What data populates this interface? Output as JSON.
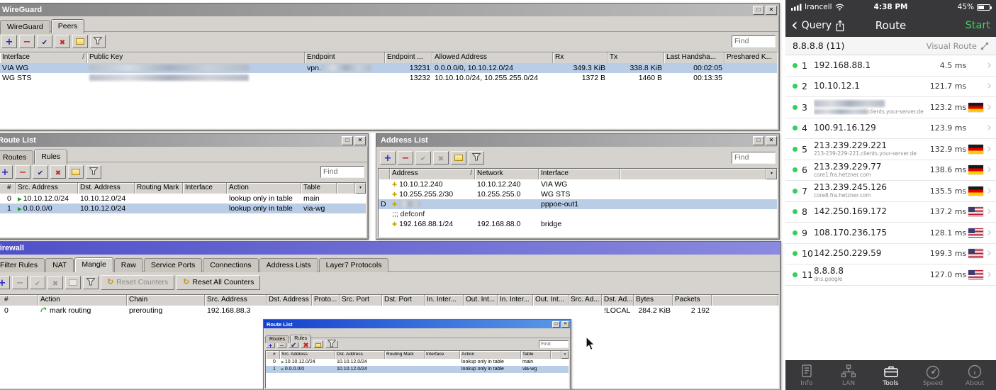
{
  "icons": {
    "maximize": "□",
    "close": "✕",
    "dropdown": "▾"
  },
  "colors": {
    "selection_blue": "#b9cde6",
    "titlebar_active": "#4f50c8",
    "ios_green": "#3fd15e",
    "hop_dot_green": "#35d05a"
  },
  "desktop": {
    "wireguard": {
      "title": "WireGuard",
      "tabs": [
        "WireGuard",
        "Peers"
      ],
      "active_tab": 1,
      "toolbar": [
        {
          "icon": "add-icon",
          "disabled": false
        },
        {
          "icon": "remove-icon",
          "disabled": false
        },
        {
          "icon": "enable-icon",
          "disabled": false
        },
        {
          "icon": "disable-icon",
          "disabled": false
        },
        {
          "icon": "comment-icon",
          "disabled": false
        },
        {
          "icon": "filter-icon",
          "disabled": false
        }
      ],
      "find_placeholder": "Find",
      "columns": [
        "Interface",
        "Public Key",
        "Endpoint",
        "Endpoint ...",
        "Allowed Address",
        "Rx",
        "Tx",
        "Last Handsha...",
        "Preshared K..."
      ],
      "sort_column": "Interface",
      "rows": [
        {
          "interface": "VIA WG",
          "public_key_redacted": true,
          "endpoint": "vpn.",
          "endpoint_redacted": true,
          "endpoint_port": "13231",
          "allowed_address": "0.0.0.0/0, 10.10.12.0/24",
          "rx": "349.3 KiB",
          "tx": "338.8 KiB",
          "last_handshake": "00:02:05",
          "preshared_key": "",
          "selected": true
        },
        {
          "interface": "WG STS",
          "public_key_redacted": true,
          "endpoint": "",
          "endpoint_redacted": false,
          "endpoint_port": "13232",
          "allowed_address": "10.10.10.0/24, 10.255.255.0/24",
          "rx": "1372 B",
          "tx": "1460 B",
          "last_handshake": "00:13:35",
          "preshared_key": "",
          "selected": false
        }
      ]
    },
    "route_list": {
      "title": "Route List",
      "tabs": [
        "Routes",
        "Rules"
      ],
      "active_tab": 1,
      "toolbar": [
        {
          "icon": "add-icon",
          "disabled": false
        },
        {
          "icon": "remove-icon",
          "disabled": false
        },
        {
          "icon": "enable-icon",
          "disabled": false
        },
        {
          "icon": "disable-icon",
          "disabled": false
        },
        {
          "icon": "comment-icon",
          "disabled": false
        },
        {
          "icon": "filter-icon",
          "disabled": false
        }
      ],
      "find_placeholder": "Find",
      "columns": [
        "#",
        "Src. Address",
        "Dst. Address",
        "Routing Mark",
        "Interface",
        "Action",
        "Table"
      ],
      "rows": [
        {
          "num": "0",
          "src": "10.10.12.0/24",
          "dst": "10.10.12.0/24",
          "routing_mark": "",
          "interface": "",
          "action": "lookup only in table",
          "table": "main",
          "selected": false
        },
        {
          "num": "1",
          "src": "0.0.0.0/0",
          "dst": "10.10.12.0/24",
          "routing_mark": "",
          "interface": "",
          "action": "lookup only in table",
          "table": "via-wg",
          "selected": true
        }
      ]
    },
    "address_list": {
      "title": "Address List",
      "toolbar": [
        {
          "icon": "add-icon",
          "disabled": false
        },
        {
          "icon": "remove-icon",
          "disabled": false
        },
        {
          "icon": "enable-icon",
          "disabled": true
        },
        {
          "icon": "disable-icon",
          "disabled": true
        },
        {
          "icon": "comment-icon",
          "disabled": false
        },
        {
          "icon": "filter-icon",
          "disabled": false
        }
      ],
      "find_placeholder": "Find",
      "columns": [
        "Address",
        "Network",
        "Interface"
      ],
      "sort_column": "Address",
      "rows": [
        {
          "flags": "",
          "address": "10.10.12.240",
          "network": "10.10.12.240",
          "interface": "VIA WG",
          "selected": false
        },
        {
          "flags": "",
          "address": "10.255.255.2/30",
          "network": "10.255.255.0",
          "interface": "WG STS",
          "selected": false
        },
        {
          "flags": "D",
          "address": "",
          "address_redacted": true,
          "network": "",
          "interface": "pppoe-out1",
          "selected": true
        },
        {
          "comment": ";;; defconf"
        },
        {
          "flags": "",
          "address": "192.168.88.1/24",
          "network": "192.168.88.0",
          "interface": "bridge",
          "selected": false
        }
      ]
    },
    "firewall": {
      "title": "Firewall",
      "tabs": [
        "Filter Rules",
        "NAT",
        "Mangle",
        "Raw",
        "Service Ports",
        "Connections",
        "Address Lists",
        "Layer7 Protocols"
      ],
      "active_tab": 2,
      "toolbar": [
        {
          "icon": "add-icon",
          "disabled": false
        },
        {
          "icon": "remove-icon",
          "disabled": true
        },
        {
          "icon": "enable-icon",
          "disabled": true
        },
        {
          "icon": "disable-icon",
          "disabled": true
        },
        {
          "icon": "comment-icon",
          "disabled": true
        },
        {
          "icon": "filter-icon",
          "disabled": false
        }
      ],
      "reset_counters_label": "Reset Counters",
      "reset_all_counters_label": "Reset All Counters",
      "columns": [
        "#",
        "Action",
        "Chain",
        "Src. Address",
        "Dst. Address",
        "Proto...",
        "Src. Port",
        "Dst. Port",
        "In. Inter...",
        "Out. Int...",
        "In. Inter...",
        "Out. Int...",
        "Src. Ad...",
        "Dst. Ad...",
        "Bytes",
        "Packets"
      ],
      "rows": [
        {
          "num": "0",
          "action": "mark routing",
          "chain": "prerouting",
          "src_address": "192.168.88.3",
          "dst_address": "",
          "protocol": "",
          "src_port": "",
          "dst_port": "",
          "in_interface": "",
          "out_interface": "",
          "in_interface_list": "",
          "out_interface_list": "",
          "src_address_list": "",
          "dst_address_list": "!LOCAL",
          "bytes": "284.2 KiB",
          "packets": "2 192",
          "selected": false
        }
      ]
    },
    "mini_route_list": {
      "title": "Route List",
      "tabs": [
        "Routes",
        "Rules"
      ],
      "active_tab": 1,
      "toolbar": [
        {
          "icon": "add-icon",
          "disabled": false
        },
        {
          "icon": "remove-icon",
          "disabled": false
        },
        {
          "icon": "enable-icon",
          "disabled": false
        },
        {
          "icon": "disable-icon",
          "disabled": false
        },
        {
          "icon": "comment-icon",
          "disabled": false
        },
        {
          "icon": "filter-icon",
          "disabled": false
        }
      ],
      "find_placeholder": "Find",
      "columns": [
        "#",
        "Src. Address",
        "Dst. Address",
        "Routing Mark",
        "Interface",
        "Action",
        "Table"
      ],
      "rows": [
        {
          "num": "0",
          "src": "10.10.12.0/24",
          "dst": "10.10.12.0/24",
          "routing_mark": "",
          "interface": "",
          "action": "lookup only in table",
          "table": "main",
          "selected": false
        },
        {
          "num": "1",
          "src": "0.0.0.0/0",
          "dst": "10.10.12.0/24",
          "routing_mark": "",
          "interface": "",
          "action": "lookup only in table",
          "table": "via-wg",
          "selected": true
        }
      ]
    }
  },
  "phone": {
    "status_bar": {
      "carrier": "Irancell",
      "time": "4:38 PM",
      "battery_percent": "45%"
    },
    "nav_bar": {
      "back_label": "Query",
      "title": "Route",
      "action_label": "Start"
    },
    "subheader": {
      "target": "8.8.8.8 (11)",
      "mode": "Visual Route"
    },
    "hops": [
      {
        "num": "1",
        "ip": "192.168.88.1",
        "latency": "4.5 ms",
        "flag": null
      },
      {
        "num": "2",
        "ip": "10.10.12.1",
        "latency": "121.7 ms",
        "flag": null
      },
      {
        "num": "3",
        "ip": "",
        "ip_redacted": true,
        "host": "clients.your-server.de",
        "host_prefix_redacted": true,
        "latency": "123.2 ms",
        "flag": "de"
      },
      {
        "num": "4",
        "ip": "100.91.16.129",
        "latency": "123.9 ms",
        "flag": null
      },
      {
        "num": "5",
        "ip": "213.239.229.221",
        "host": "213-239-229-221.clients.your-server.de",
        "latency": "132.9 ms",
        "flag": "de"
      },
      {
        "num": "6",
        "ip": "213.239.229.77",
        "host": "core1.fra.hetzner.com",
        "latency": "138.6 ms",
        "flag": "de"
      },
      {
        "num": "7",
        "ip": "213.239.245.126",
        "host": "core8.fra.hetzner.com",
        "latency": "135.5 ms",
        "flag": "de"
      },
      {
        "num": "8",
        "ip": "142.250.169.172",
        "latency": "137.2 ms",
        "flag": "us"
      },
      {
        "num": "9",
        "ip": "108.170.236.175",
        "latency": "128.1 ms",
        "flag": "us"
      },
      {
        "num": "10",
        "ip": "142.250.229.59",
        "latency": "199.3 ms",
        "flag": "us"
      },
      {
        "num": "11",
        "ip": "8.8.8.8",
        "host": "dns.google",
        "latency": "127.0 ms",
        "flag": "us"
      }
    ],
    "tab_bar": {
      "items": [
        {
          "label": "Info",
          "icon": "info-doc-icon",
          "active": false
        },
        {
          "label": "LAN",
          "icon": "lan-icon",
          "active": false
        },
        {
          "label": "Tools",
          "icon": "tools-icon",
          "active": true
        },
        {
          "label": "Speed",
          "icon": "speed-icon",
          "active": false
        },
        {
          "label": "About",
          "icon": "about-icon",
          "active": false
        }
      ]
    }
  }
}
